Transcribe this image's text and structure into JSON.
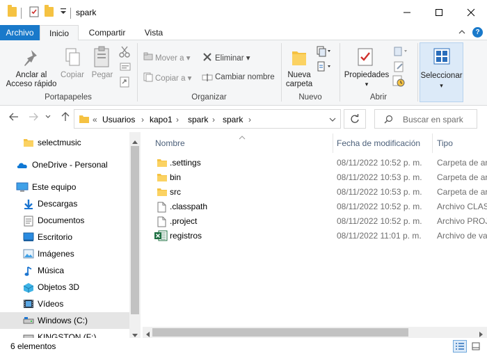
{
  "window": {
    "title": "spark",
    "minimize_glyph": "—",
    "maximize_glyph": "☐",
    "close_glyph": "✕"
  },
  "tabs": {
    "archivo": "Archivo",
    "inicio": "Inicio",
    "compartir": "Compartir",
    "vista": "Vista",
    "collapse_glyph": "⌃",
    "help_glyph": "?"
  },
  "ribbon": {
    "portapapeles": {
      "label": "Portapapeles",
      "anclar_line1": "Anclar al",
      "anclar_line2": "Acceso rápido",
      "copiar": "Copiar",
      "pegar": "Pegar"
    },
    "organizar": {
      "label": "Organizar",
      "mover": "Mover a",
      "copiar_a": "Copiar a",
      "eliminar": "Eliminar",
      "cambiar_nombre": "Cambiar nombre"
    },
    "nuevo": {
      "label": "Nuevo",
      "nueva_line1": "Nueva",
      "nueva_line2": "carpeta"
    },
    "abrir": {
      "label": "Abrir",
      "propiedades": "Propiedades"
    },
    "seleccionar": {
      "label": "Seleccionar"
    }
  },
  "address": {
    "overflow": "«",
    "breadcrumbs": [
      "Usuarios",
      "kapo1",
      "spark",
      "spark"
    ],
    "separator": "›",
    "search_placeholder": "Buscar en spark"
  },
  "nav": {
    "items": [
      {
        "label": "selectmusic",
        "icon": "folder-icon"
      },
      {
        "label": "OneDrive - Personal",
        "icon": "onedrive-icon"
      },
      {
        "label": "Este equipo",
        "icon": "computer-icon"
      },
      {
        "label": "Descargas",
        "icon": "download-icon"
      },
      {
        "label": "Documentos",
        "icon": "documents-icon"
      },
      {
        "label": "Escritorio",
        "icon": "desktop-icon"
      },
      {
        "label": "Imágenes",
        "icon": "pictures-icon"
      },
      {
        "label": "Música",
        "icon": "music-icon"
      },
      {
        "label": "Objetos 3D",
        "icon": "objects-3d-icon"
      },
      {
        "label": "Vídeos",
        "icon": "videos-icon"
      },
      {
        "label": "Windows (C:)",
        "icon": "drive-icon"
      },
      {
        "label": "KINGSTON (F:)",
        "icon": "usb-drive-icon"
      }
    ],
    "selected": "Windows (C:)"
  },
  "files": {
    "columns": {
      "name": "Nombre",
      "date": "Fecha de modificación",
      "type": "Tipo"
    },
    "rows": [
      {
        "name": ".settings",
        "date": "08/11/2022 10:52 p. m.",
        "type": "Carpeta de ar",
        "icon": "folder-icon"
      },
      {
        "name": "bin",
        "date": "08/11/2022 10:53 p. m.",
        "type": "Carpeta de ar",
        "icon": "folder-icon"
      },
      {
        "name": "src",
        "date": "08/11/2022 10:53 p. m.",
        "type": "Carpeta de ar",
        "icon": "folder-icon"
      },
      {
        "name": ".classpath",
        "date": "08/11/2022 10:52 p. m.",
        "type": "Archivo CLAS",
        "icon": "file-icon"
      },
      {
        "name": ".project",
        "date": "08/11/2022 10:52 p. m.",
        "type": "Archivo PROJ",
        "icon": "file-icon"
      },
      {
        "name": "registros",
        "date": "08/11/2022 11:01 p. m.",
        "type": "Archivo de va",
        "icon": "excel-icon"
      }
    ]
  },
  "status": {
    "count": "6 elementos"
  },
  "colors": {
    "accent": "#1979ca",
    "folder": "#f5c242",
    "excel": "#1d6f42"
  }
}
